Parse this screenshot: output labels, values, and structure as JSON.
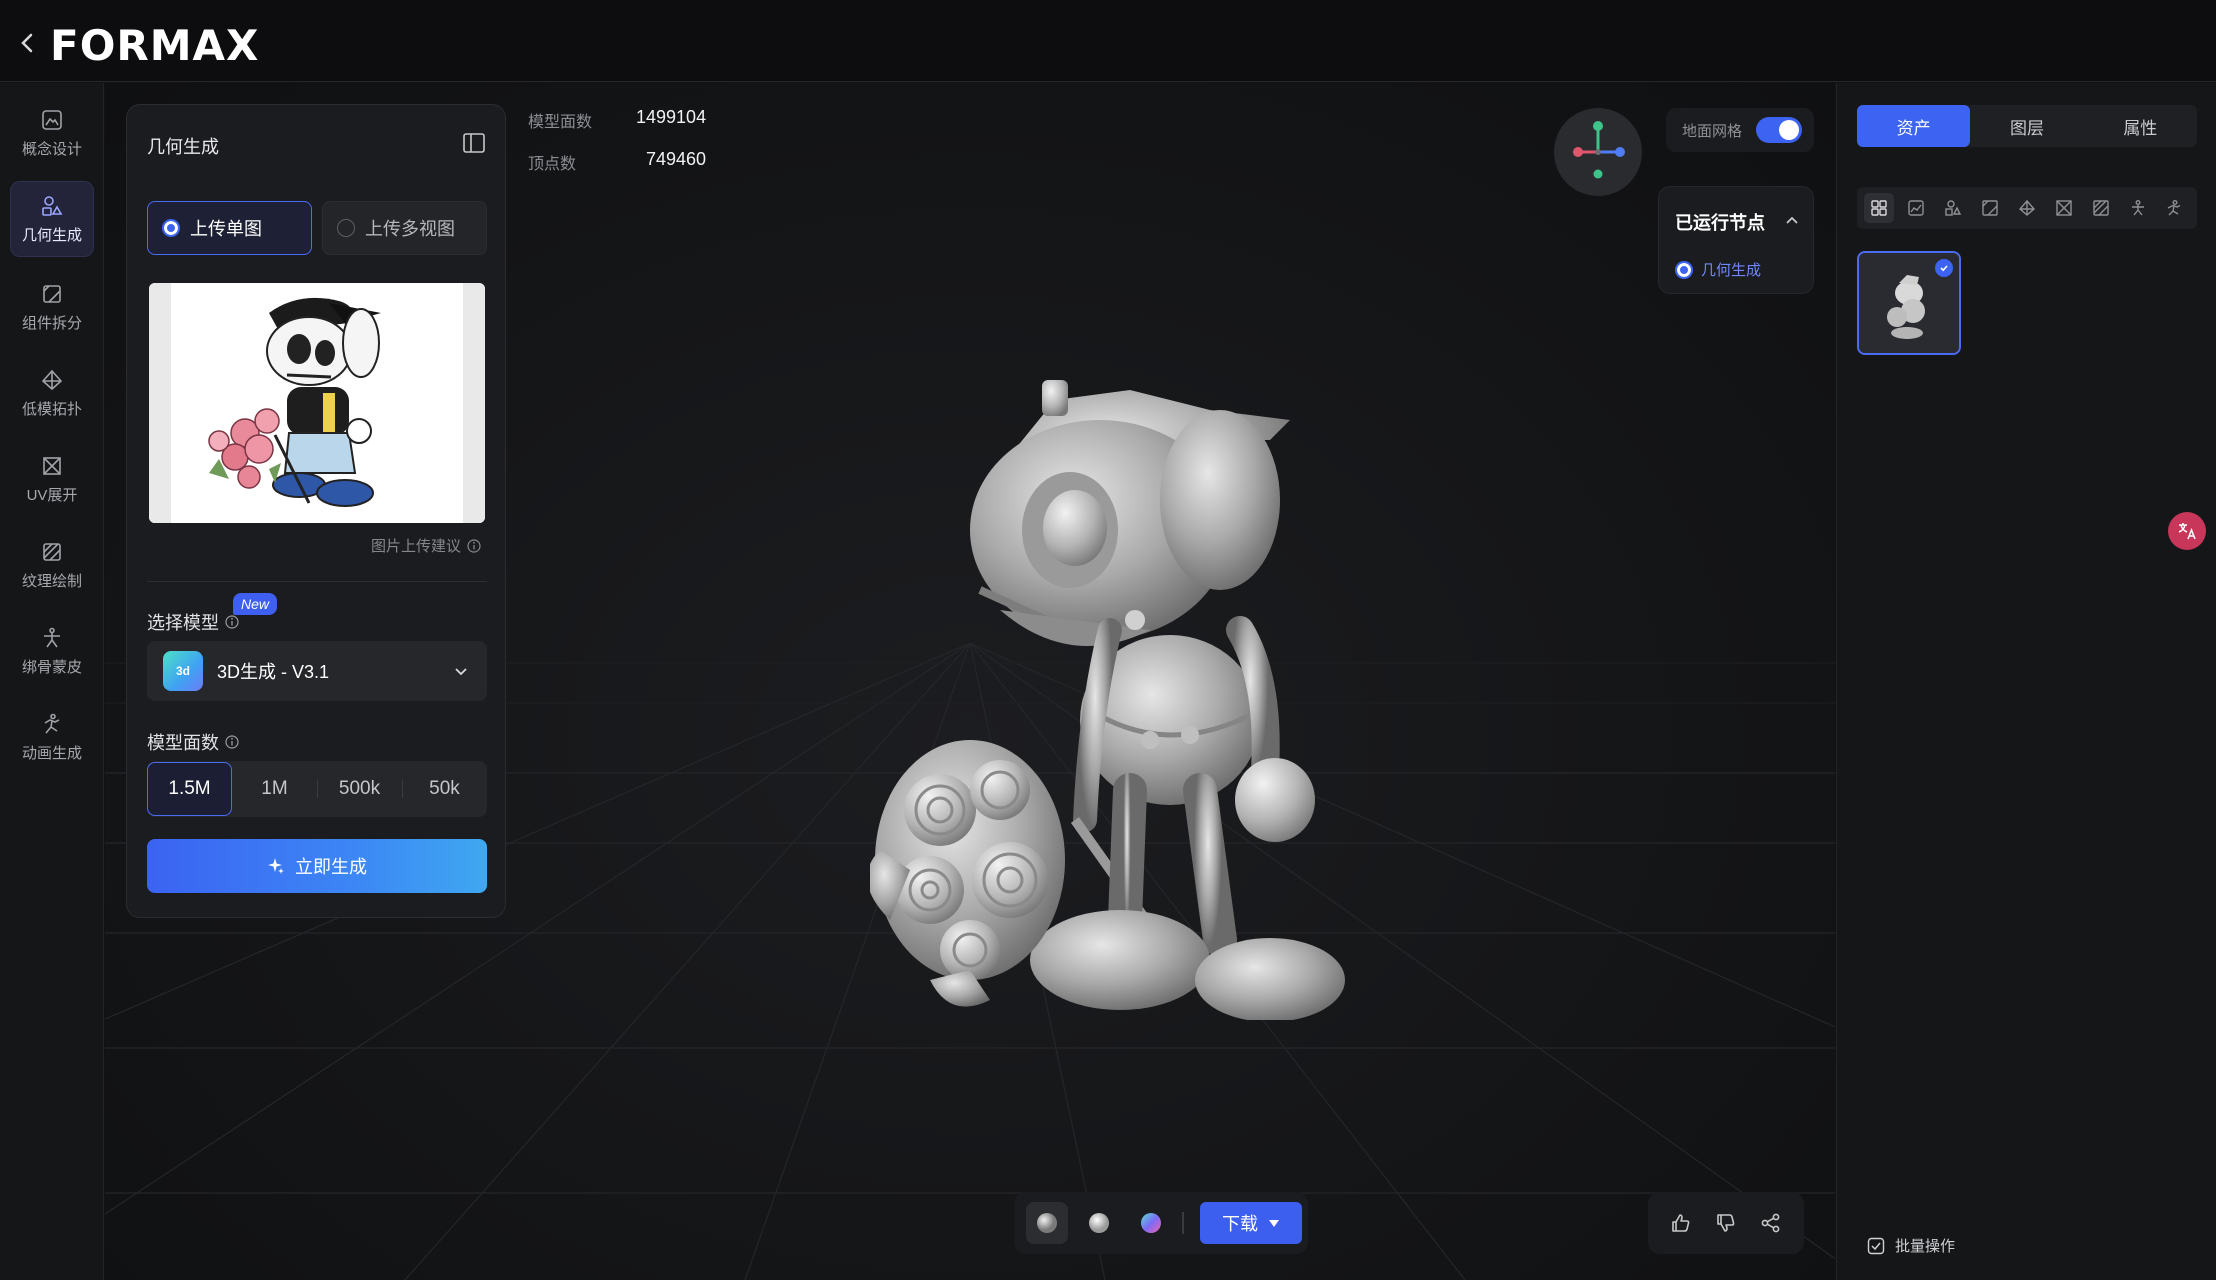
{
  "app": {
    "logo_text": "FORMAX"
  },
  "rail": {
    "items": [
      {
        "label": "概念设计",
        "icon": "concept-design-icon"
      },
      {
        "label": "几何生成",
        "icon": "geometry-gen-icon"
      },
      {
        "label": "组件拆分",
        "icon": "component-split-icon"
      },
      {
        "label": "低模拓扑",
        "icon": "low-poly-icon"
      },
      {
        "label": "UV展开",
        "icon": "uv-unwrap-icon"
      },
      {
        "label": "纹理绘制",
        "icon": "texture-paint-icon"
      },
      {
        "label": "绑骨蒙皮",
        "icon": "rigging-icon"
      },
      {
        "label": "动画生成",
        "icon": "animation-icon"
      }
    ],
    "active_index": 1
  },
  "panel": {
    "title": "几何生成",
    "upload_single": "上传单图",
    "upload_multi": "上传多视图",
    "upload_hint": "图片上传建议",
    "model_label": "选择模型",
    "new_badge": "New",
    "model_logo": "3d",
    "model_name": "3D生成 - V3.1",
    "faces_label": "模型面数",
    "faces_options": [
      "1.5M",
      "1M",
      "500k",
      "50k"
    ],
    "faces_selected": "1.5M",
    "generate_label": "立即生成"
  },
  "stats": {
    "faces_label": "模型面数",
    "faces_value": "1499104",
    "verts_label": "顶点数",
    "verts_value": "749460"
  },
  "viewport": {
    "ground_grid_label": "地面网格",
    "ground_grid_on": true,
    "nodes_title": "已运行节点",
    "nodes_item": "几何生成"
  },
  "toolbar": {
    "download_label": "下载",
    "render_modes": [
      "solid-shading-icon",
      "matcap-shading-icon",
      "color-shading-icon"
    ]
  },
  "feedback": [
    "thumbs-up-icon",
    "thumbs-down-icon",
    "share-icon"
  ],
  "right_panel": {
    "tabs": [
      "资产",
      "图层",
      "属性"
    ],
    "active_tab": "资产",
    "batch_label": "批量操作"
  },
  "colors": {
    "accent": "#3d63f2",
    "bg": "#111214",
    "panel": "#1b1c1f"
  }
}
